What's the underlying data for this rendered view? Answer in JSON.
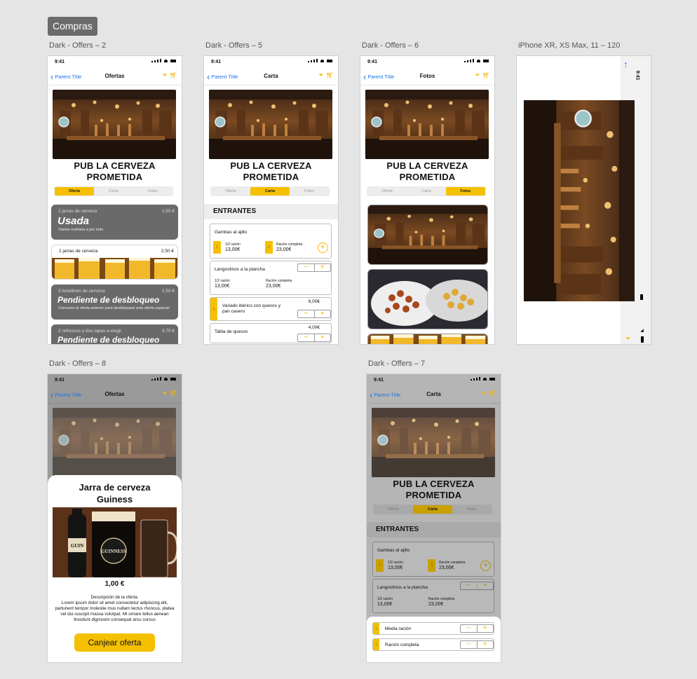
{
  "page_tag": "Compras",
  "artboards": {
    "a1": {
      "label": "Dark - Offers – 2",
      "time": "9:41",
      "back": "Parent Title",
      "title": "Ofertas"
    },
    "a2": {
      "label": "Dark - Offers – 5",
      "time": "9:41",
      "back": "Parent Title",
      "title": "Carta"
    },
    "a3": {
      "label": "Dark - Offers – 6",
      "time": "9:41",
      "back": "Parent Title",
      "title": "Fotos"
    },
    "a4": {
      "label": "iPhone XR, XS Max, 11 – 120",
      "time": "9:41"
    },
    "a5": {
      "label": "Dark - Offers – 8",
      "time": "9:41",
      "back": "Parent Title",
      "title": "Ofertas"
    },
    "a6": {
      "label": "Dark - Offers – 7",
      "time": "9:41",
      "back": "Parent Title",
      "title": "Carta"
    }
  },
  "pub": {
    "name_line1": "PUB LA CERVEZA",
    "name_line2": "PROMETIDA"
  },
  "tabs": [
    "Oferta",
    "Carta",
    "Fotos"
  ],
  "offers": [
    {
      "desc": "2 jarras de cerveza",
      "price": "2,50 €",
      "headline": "Usada",
      "sub": "Vuelve mañana a por más"
    },
    {
      "desc": "2 jarras de cerveza",
      "price": "2,50 €"
    },
    {
      "desc": "3 botellines de cerveza",
      "price": "2,50 €",
      "headline": "Pendiente de desbloqueo",
      "sub": "Consume la oferta anterior para desbloquear esta oferta especial"
    },
    {
      "desc": "2 refrescos y dos tapas a elegir",
      "price": "3,70 €",
      "headline": "Pendiente de desbloqueo"
    }
  ],
  "menu": {
    "section": "ENTRANTES",
    "items": [
      {
        "name": "Gambas al ajillo",
        "half_label": "1/2 ración",
        "half_price": "13,00€",
        "full_label": "Ración completa",
        "full_price": "23,00€"
      },
      {
        "name": "Langostinos a la plancha",
        "half_label": "1/2 ración",
        "half_price": "13,00€",
        "full_label": "Ración completa",
        "full_price": "23,00€"
      },
      {
        "name_line1": "Variado ibérico con quesos y",
        "name_line2": "pan casero",
        "price": "6,00€"
      },
      {
        "name": "Tabla de quesos",
        "price": "4,00€"
      }
    ]
  },
  "detail": {
    "title_line1": "Jarra de cerveza",
    "title_line2": "Guiness",
    "price": "1,00 €",
    "desc_title": "Descripción de la oferta.",
    "desc_body": "Lorem ipsum dolor sit amet consectetur adipiscing elit, parturient tempor molestie mus nullam lectus rhoncus, platea vel dui suscipit massa volutpat. Mi ornare tellus aenean tincidunt dignissim consequat arcu cursus",
    "button": "Canjear oferta",
    "bottle_text": "GUINNESS"
  },
  "sheet": {
    "rows": [
      {
        "n": "1",
        "label": "Media ración"
      },
      {
        "n": "2",
        "label": "Ración completa"
      }
    ]
  },
  "icons": {
    "back": "chevron-left-icon",
    "filter": "filter-icon",
    "cart": "cart-icon",
    "add": "plus-circle-icon",
    "rotate": "arrow-up-icon"
  },
  "colors": {
    "accent": "#f5c000",
    "link": "#1a73e8",
    "canvas": "#e5e5e5"
  }
}
